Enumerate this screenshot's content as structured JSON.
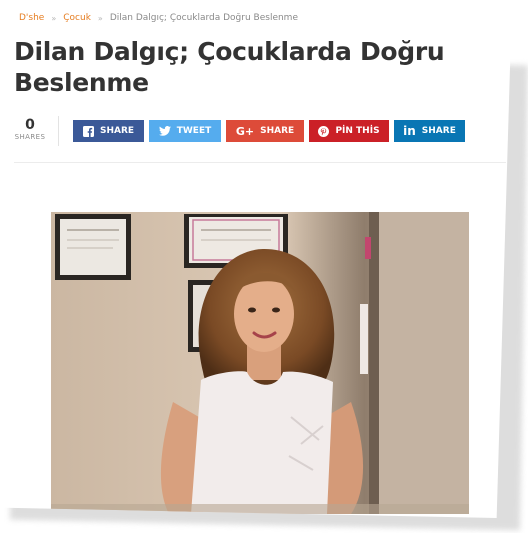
{
  "breadcrumb": {
    "home": "D'she",
    "category": "Çocuk",
    "current": "Dilan Dalgıç; Çocuklarda Doğru Beslenme",
    "separator": "»"
  },
  "article": {
    "title": "Dilan Dalgıç; Çocuklarda Doğru Beslenme"
  },
  "shares": {
    "count": "0",
    "label": "SHARES"
  },
  "share_buttons": [
    {
      "network": "facebook",
      "icon": "facebook-icon",
      "label": "SHARE",
      "color": "#3b5998"
    },
    {
      "network": "twitter",
      "icon": "twitter-icon",
      "label": "TWEET",
      "color": "#55acee"
    },
    {
      "network": "google-plus",
      "icon": "google-plus-icon",
      "label": "SHARE",
      "color": "#dd4b39"
    },
    {
      "network": "pinterest",
      "icon": "pinterest-icon",
      "label": "PİN THİS",
      "color": "#cb2027"
    },
    {
      "network": "linkedin",
      "icon": "linkedin-icon",
      "label": "SHARE",
      "color": "#0976b4"
    }
  ],
  "colors": {
    "accent": "#e67e22",
    "title": "#333333"
  }
}
